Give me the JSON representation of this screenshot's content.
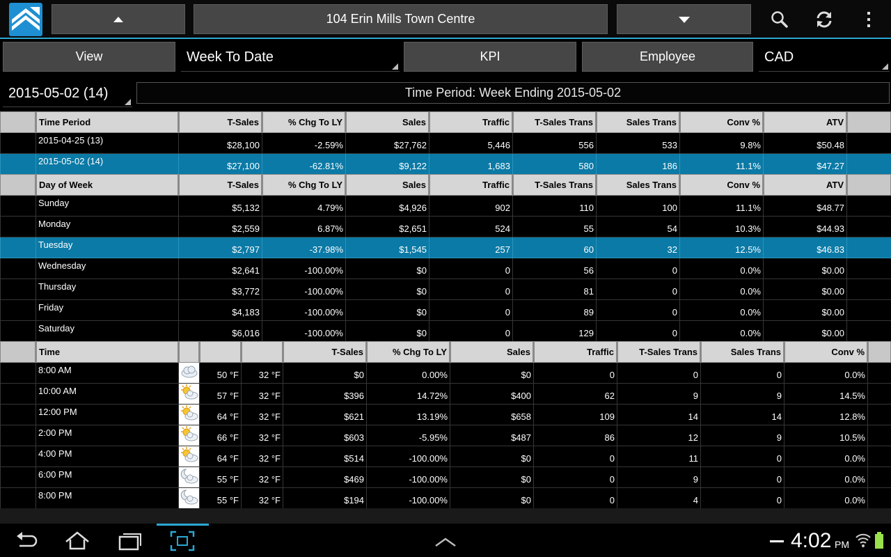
{
  "actionbar": {
    "store_name": "104 Erin Mills Town Centre"
  },
  "selectors": {
    "view_label": "View",
    "period_value": "Week To Date",
    "kpi_label": "KPI",
    "employee_label": "Employee",
    "currency_value": "CAD",
    "date_value": "2015-05-02 (14)",
    "time_period_banner": "Time Period: Week Ending 2015-05-02"
  },
  "period_table": {
    "headers": [
      "Time Period",
      "T-Sales",
      "% Chg To LY",
      "Sales",
      "Traffic",
      "T-Sales Trans",
      "Sales Trans",
      "Conv %",
      "ATV"
    ],
    "rows": [
      [
        "2015-04-25 (13)",
        "$28,100",
        "-2.59%",
        "$27,762",
        "5,446",
        "556",
        "533",
        "9.8%",
        "$50.48"
      ],
      [
        "2015-05-02 (14)",
        "$27,100",
        "-62.81%",
        "$9,122",
        "1,683",
        "580",
        "186",
        "11.1%",
        "$47.27"
      ]
    ]
  },
  "day_table": {
    "headers": [
      "Day of Week",
      "T-Sales",
      "% Chg To LY",
      "Sales",
      "Traffic",
      "T-Sales Trans",
      "Sales Trans",
      "Conv %",
      "ATV"
    ],
    "rows": [
      [
        "Sunday",
        "$5,132",
        "4.79%",
        "$4,926",
        "902",
        "110",
        "100",
        "11.1%",
        "$48.77"
      ],
      [
        "Monday",
        "$2,559",
        "6.87%",
        "$2,651",
        "524",
        "55",
        "54",
        "10.3%",
        "$44.93"
      ],
      [
        "Tuesday",
        "$2,797",
        "-37.98%",
        "$1,545",
        "257",
        "60",
        "32",
        "12.5%",
        "$46.83"
      ],
      [
        "Wednesday",
        "$2,641",
        "-100.00%",
        "$0",
        "0",
        "56",
        "0",
        "0.0%",
        "$0.00"
      ],
      [
        "Thursday",
        "$3,772",
        "-100.00%",
        "$0",
        "0",
        "81",
        "0",
        "0.0%",
        "$0.00"
      ],
      [
        "Friday",
        "$4,183",
        "-100.00%",
        "$0",
        "0",
        "89",
        "0",
        "0.0%",
        "$0.00"
      ],
      [
        "Saturday",
        "$6,016",
        "-100.00%",
        "$0",
        "0",
        "129",
        "0",
        "0.0%",
        "$0.00"
      ]
    ]
  },
  "time_table": {
    "headers": [
      "Time",
      "",
      "",
      "",
      "T-Sales",
      "% Chg To LY",
      "Sales",
      "Traffic",
      "T-Sales Trans",
      "Sales Trans",
      "Conv %"
    ],
    "rows": [
      {
        "time": "8:00 AM",
        "weather": "cloud-icon",
        "temp": "50 °F",
        "temp_level": "cold",
        "low": "32 °F",
        "values": [
          "$0",
          "0.00%",
          "$0",
          "0",
          "0",
          "0",
          "0.0%"
        ]
      },
      {
        "time": "10:00 AM",
        "weather": "partly-sunny-icon",
        "temp": "57 °F",
        "temp_level": "normal",
        "low": "32 °F",
        "values": [
          "$396",
          "14.72%",
          "$400",
          "62",
          "9",
          "9",
          "14.5%"
        ]
      },
      {
        "time": "12:00 PM",
        "weather": "partly-sunny-icon",
        "temp": "64 °F",
        "temp_level": "hot",
        "low": "32 °F",
        "values": [
          "$621",
          "13.19%",
          "$658",
          "109",
          "14",
          "14",
          "12.8%"
        ]
      },
      {
        "time": "2:00 PM",
        "weather": "partly-sunny-icon",
        "temp": "66 °F",
        "temp_level": "hot",
        "low": "32 °F",
        "values": [
          "$603",
          "-5.95%",
          "$487",
          "86",
          "12",
          "9",
          "10.5%"
        ]
      },
      {
        "time": "4:00 PM",
        "weather": "partly-sunny-icon",
        "temp": "64 °F",
        "temp_level": "hot",
        "low": "32 °F",
        "values": [
          "$514",
          "-100.00%",
          "$0",
          "0",
          "11",
          "0",
          "0.0%"
        ]
      },
      {
        "time": "6:00 PM",
        "weather": "cloudy-night-icon",
        "temp": "55 °F",
        "temp_level": "normal",
        "low": "32 °F",
        "values": [
          "$469",
          "-100.00%",
          "$0",
          "0",
          "9",
          "0",
          "0.0%"
        ]
      },
      {
        "time": "8:00 PM",
        "weather": "cloudy-night-icon",
        "temp": "55 °F",
        "temp_level": "normal",
        "low": "32 °F",
        "values": [
          "$194",
          "-100.00%",
          "$0",
          "0",
          "4",
          "0",
          "0.0%"
        ]
      }
    ]
  },
  "selected": {
    "period_row": 1,
    "day_row": 2
  },
  "statusbar": {
    "time": "4:02",
    "ampm": "PM"
  },
  "colors": {
    "accent": "#2aa8d4",
    "selected_row": "#0b7aa6",
    "header_row": "#d6d6d6",
    "temp_hot": "#ff2a2a",
    "temp_cold": "#8cc8ff"
  }
}
